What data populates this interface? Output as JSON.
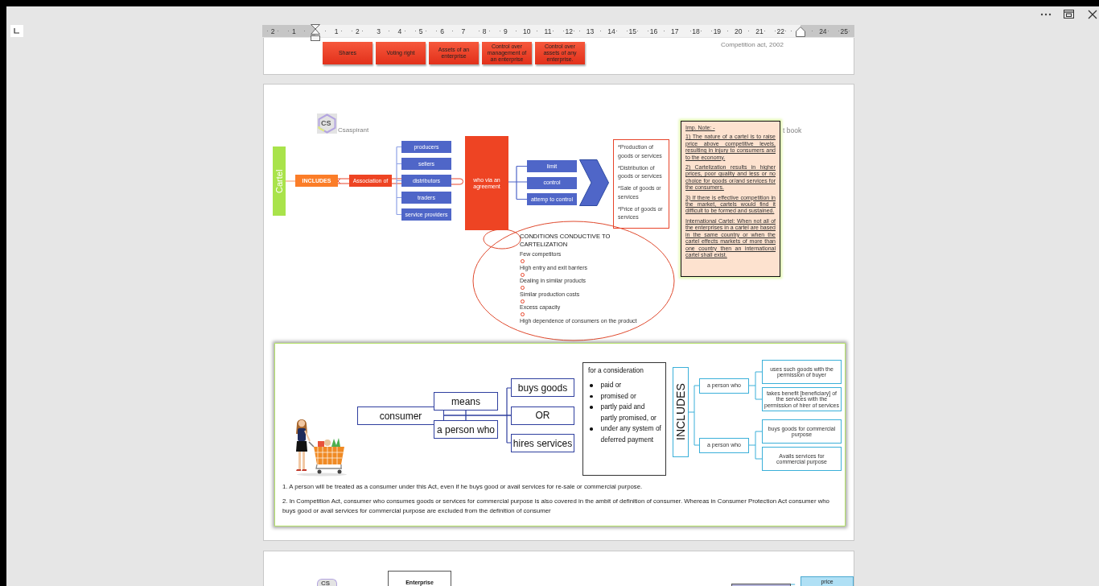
{
  "ruler": {
    "left_numbers": [
      "2",
      "1"
    ],
    "numbers": [
      "1",
      "2",
      "3",
      "4",
      "5",
      "6",
      "7",
      "8",
      "9",
      "10",
      "11",
      "12",
      "13",
      "14",
      "15",
      "16",
      "17",
      "18",
      "19",
      "20",
      "21",
      "22"
    ],
    "right_numbers": [
      "24",
      "25"
    ]
  },
  "page_1": {
    "boxes": [
      "Shares",
      "Voting right",
      "Assets of an enterprise",
      "Control over management of an enterprise",
      "Control over assets of any enterprise."
    ],
    "caption": "Competition act, 2002"
  },
  "page_2": {
    "logo": {
      "mark": "CS",
      "name": "Csaspirant"
    },
    "caption_fragment": "t book",
    "cartel": {
      "title": "Cartel",
      "includes": "INCLUDES",
      "association": "Association of",
      "members": [
        "producers",
        "sellers",
        "distributors",
        "traders",
        "service providers"
      ],
      "agreement": "who via an agreement",
      "actions": [
        "limit",
        "control",
        "attemp to control"
      ],
      "objects": [
        "*Production of goods or services",
        "*Distribution of goods or services",
        "*Sale of goods or services",
        "*Price of goods or services"
      ]
    },
    "note": {
      "title": "Imp. Note: -",
      "paragraphs": [
        "1) The nature of a cartel is to raise price above competitive levels, resulting in injury to consumers and to the economy.",
        "2) Cartelization results in higher prices, poor quality and less or no choice for goods or/and services for the consumers.",
        "3) If there is effective competition in the market, cartels would find it difficult to be formed and sustained.",
        "International Cartel: When not all of the enterprises in a cartel are based in the same country or when the cartel effects markets of more than one country then an international cartel shall exist."
      ]
    },
    "conditions": {
      "title": "CONDITIONS CONDUCTIVE TO CARTELIZATION",
      "items": [
        {
          "text": "Few competitors",
          "bullet": false
        },
        {
          "text": "High entry and exit barriers",
          "bullet": true
        },
        {
          "text": "Dealing in similar products",
          "bullet": true
        },
        {
          "text": "Similar production costs",
          "bullet": true
        },
        {
          "text": "Excess capacity",
          "bullet": true
        },
        {
          "text": "High dependence of consumers on the product",
          "bullet": true
        }
      ]
    },
    "consumer": {
      "term": "consumer",
      "means": "means",
      "who": "a person who",
      "acts": [
        "buys goods",
        "OR",
        "hires services"
      ],
      "consideration": {
        "title": "for a consideration",
        "items": [
          "paid or",
          "promised or",
          "partly paid and partly promised, or",
          "under any system of deferred payment"
        ]
      },
      "includes": "INCLUDES",
      "groups": [
        {
          "label": "a person who",
          "cases": [
            "uses such goods with the permission of buyer",
            "takes benefit [beneficiary] of the services with the permission of hirer of services"
          ]
        },
        {
          "label": "a person who",
          "cases": [
            "buys goods for commercial purpose",
            "Avails services for commercial purpose"
          ]
        }
      ],
      "notes": [
        "1. A person will be treated as a consumer under this Act, even if he buys good or avail services for re-sale or commercial purpose.",
        "2. In Competition Act, consumer who consumes goods or services for commercial purpose is also covered in the ambit of definition of consumer. Whereas in Consumer Protection Act consumer who buys good or avail services for commercial purpose are excluded from the definition of consumer"
      ]
    }
  },
  "page_3": {
    "logo_mark": "CS",
    "box": "Enterprise",
    "price": "price"
  }
}
